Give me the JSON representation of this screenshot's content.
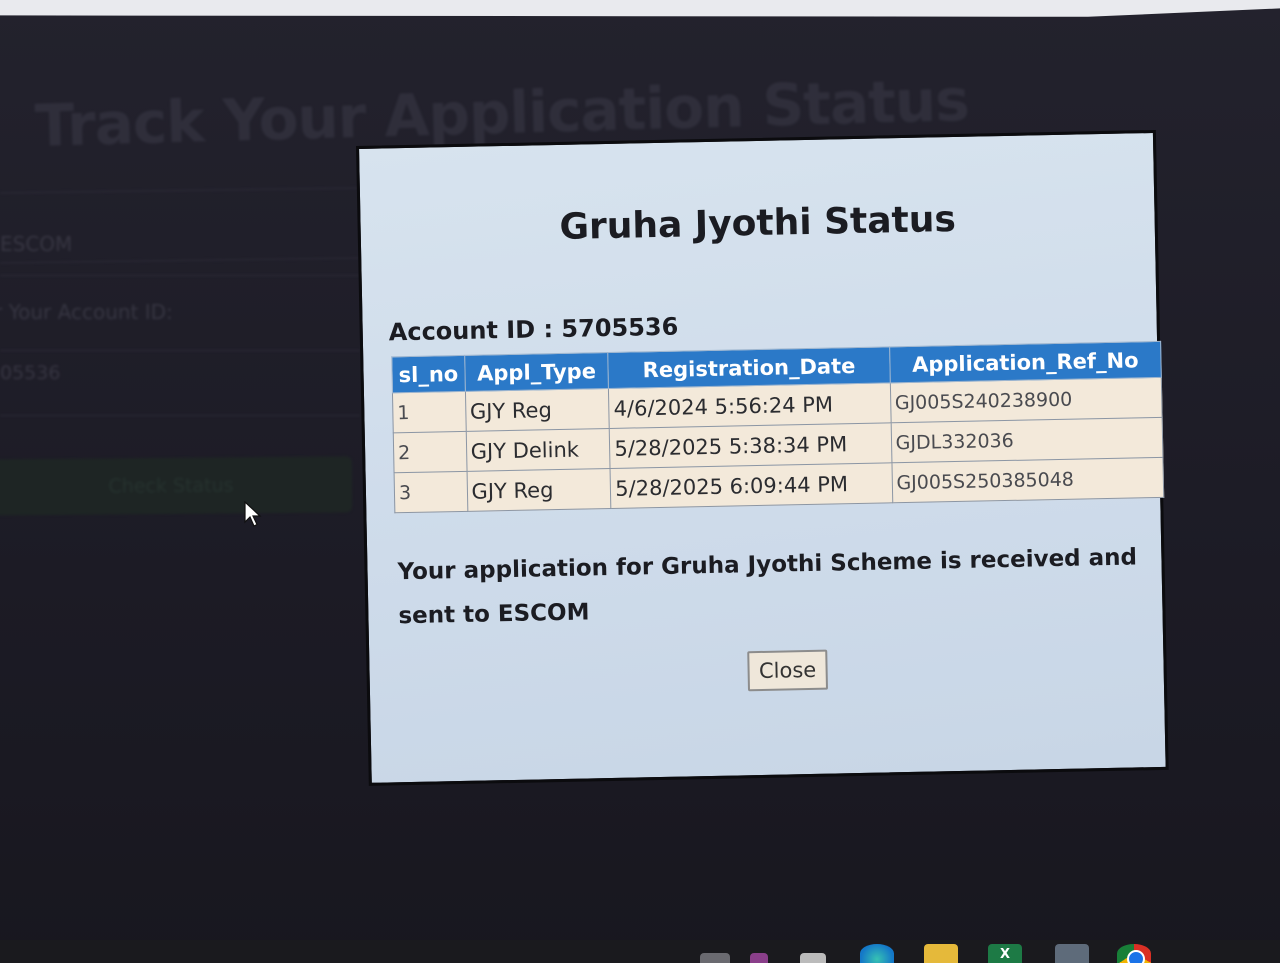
{
  "background_page": {
    "title": "Track Your Application Status",
    "escom_label": "ESCOM",
    "account_label": "r Your Account ID:",
    "account_value": "05536",
    "check_button_label": "Check Status"
  },
  "modal": {
    "title": "Gruha Jyothi Status",
    "account_line": "Account ID : 5705536",
    "table": {
      "headers": [
        "sl_no",
        "Appl_Type",
        "Registration_Date",
        "Application_Ref_No"
      ],
      "rows": [
        [
          "1",
          "GJY Reg",
          "4/6/2024 5:56:24 PM",
          "GJ005S240238900"
        ],
        [
          "2",
          "GJY Delink",
          "5/28/2025 5:38:34 PM",
          "GJDL332036"
        ],
        [
          "3",
          "GJY Reg",
          "5/28/2025 6:09:44 PM",
          "GJ005S250385048"
        ]
      ]
    },
    "message": "Your application for Gruha Jyothi Scheme is received and sent to ESCOM",
    "close_label": "Close"
  },
  "taskbar": {
    "icons": [
      "edge-icon",
      "folder-icon",
      "excel-icon",
      "calculator-icon",
      "chrome-icon"
    ],
    "excel_glyph": "X"
  },
  "colors": {
    "modal_bg": "#d3e0ec",
    "table_header": "#2b79c8",
    "table_cell": "#f3e9da"
  }
}
